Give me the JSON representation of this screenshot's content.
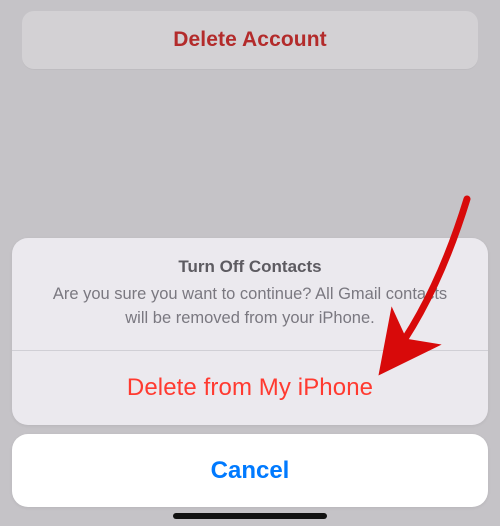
{
  "top_button": {
    "label": "Delete Account"
  },
  "sheet": {
    "title": "Turn Off Contacts",
    "description": "Are you sure you want to continue? All Gmail contacts will be removed from your iPhone.",
    "destructive_label": "Delete from My iPhone",
    "cancel_label": "Cancel"
  },
  "annotation": {
    "arrow_color": "#d80a0a"
  }
}
